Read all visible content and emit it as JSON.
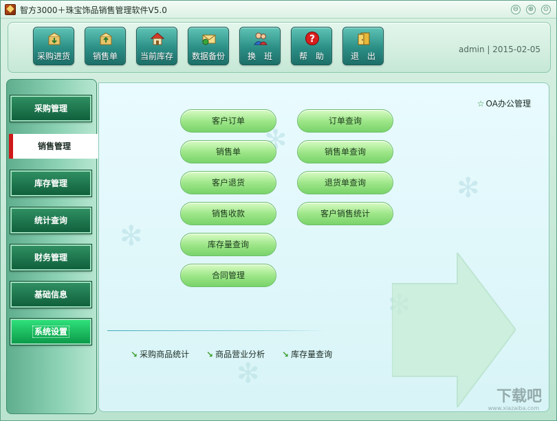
{
  "window": {
    "title": "智方3000＋珠宝饰品销售管理软件V5.0",
    "controls": [
      "⊖",
      "⊕",
      "⊙"
    ]
  },
  "toolbar": {
    "buttons": [
      {
        "label": "采购进货",
        "icon": "box-in-icon"
      },
      {
        "label": "销售单",
        "icon": "box-out-icon"
      },
      {
        "label": "当前库存",
        "icon": "house-icon"
      },
      {
        "label": "数据备份",
        "icon": "envelope-backup-icon"
      },
      {
        "label": "换　班",
        "icon": "users-icon"
      },
      {
        "label": "帮　助",
        "icon": "help-icon"
      },
      {
        "label": "退　出",
        "icon": "exit-door-icon"
      }
    ],
    "user_info": "admin | 2015-02-05"
  },
  "nav": {
    "items": [
      {
        "label": "采购管理"
      },
      {
        "label": "销售管理",
        "active": true
      },
      {
        "label": "库存管理"
      },
      {
        "label": "统计查询"
      },
      {
        "label": "财务管理"
      },
      {
        "label": "基础信息"
      },
      {
        "label": "系统设置",
        "highlighted": true
      }
    ]
  },
  "main": {
    "oa_link": "OA办公管理",
    "left_buttons": [
      "客户订单",
      "销售单",
      "客户退货",
      "销售收款",
      "库存量查询",
      "合同管理"
    ],
    "right_buttons": [
      "订单查询",
      "销售单查询",
      "退货单查询",
      "客户销售统计"
    ],
    "quick_links": [
      "采购商品统计",
      "商品营业分析",
      "库存量查询"
    ]
  },
  "watermark": {
    "text": "下载吧",
    "sub": "www.xiazaiba.com"
  },
  "colors": {
    "toolbar_button": "#2b8f86",
    "nav_button": "#10603c",
    "nav_active_marker": "#d01818",
    "func_button": "#9fe78a",
    "main_bg": "#e9fbff"
  }
}
